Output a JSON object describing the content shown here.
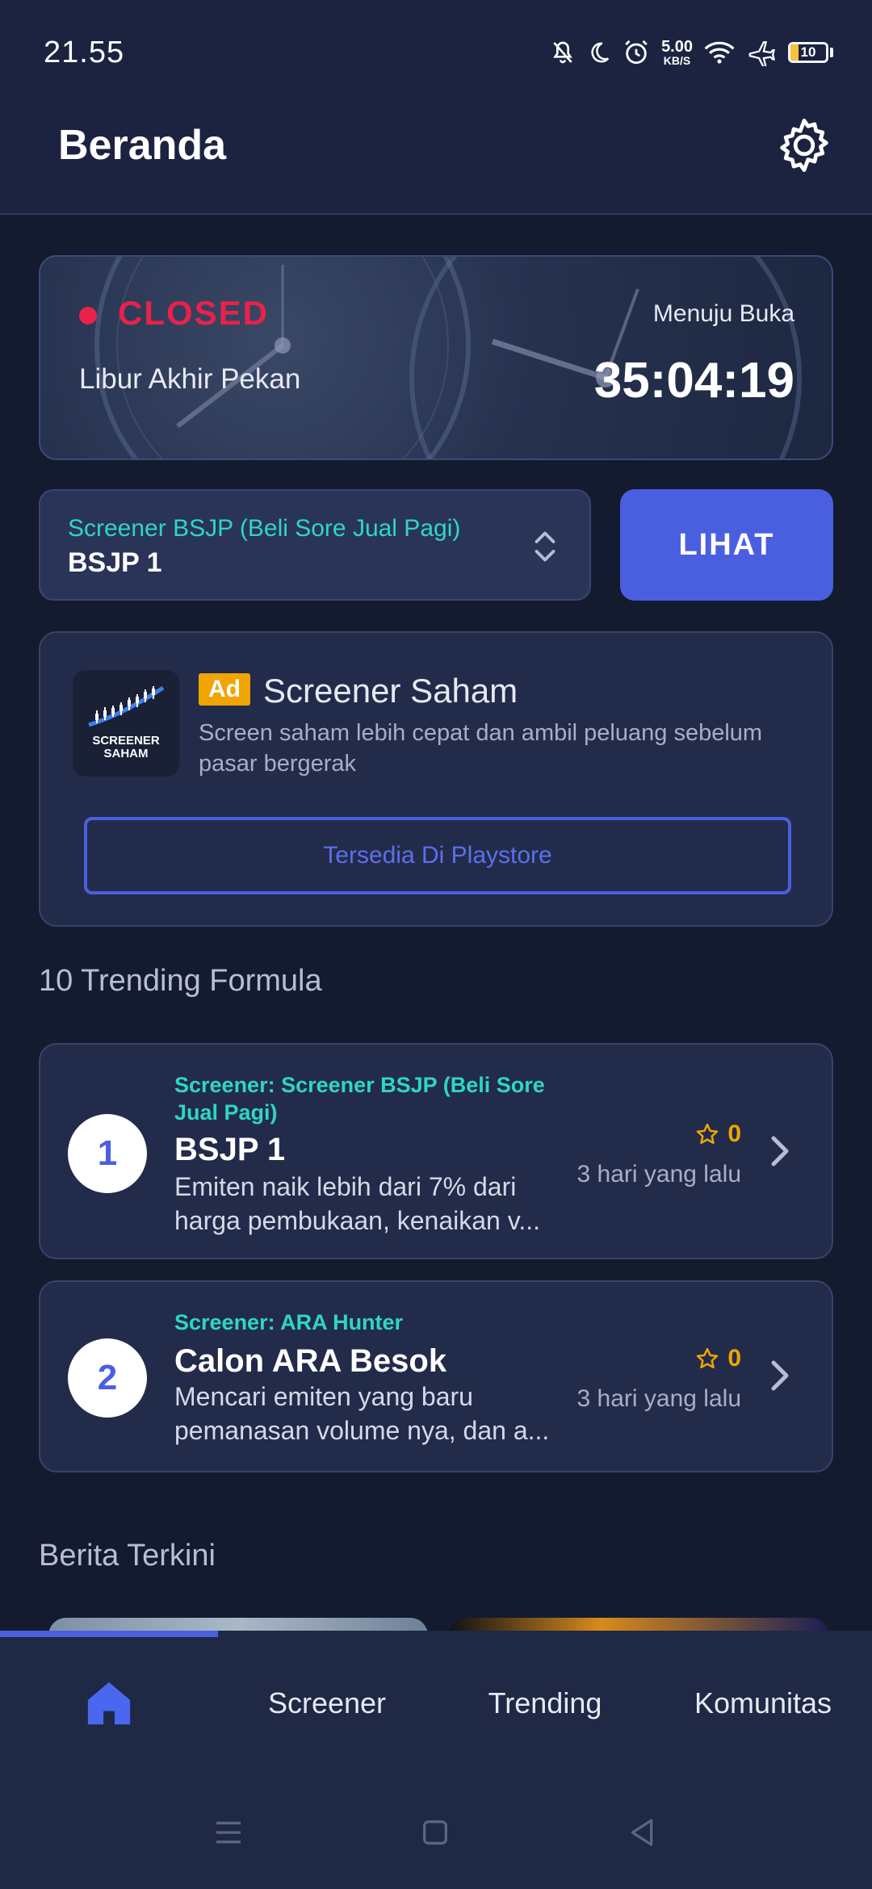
{
  "status_bar": {
    "time": "21.55",
    "speed_value": "5.00",
    "speed_unit": "KB/S",
    "battery": "10",
    "icons": [
      "bell-off-icon",
      "moon-icon",
      "alarm-icon",
      "wifi-icon",
      "airplane-icon",
      "battery-icon"
    ]
  },
  "app_bar": {
    "title": "Beranda",
    "settings_icon": "gear-icon"
  },
  "market": {
    "status": "CLOSED",
    "status_color": "#e8224a",
    "reason": "Libur Akhir Pekan",
    "countdown_caption": "Menuju Buka",
    "countdown": "35:04:19"
  },
  "screener_select": {
    "caption": "Screener BSJP (Beli Sore Jual Pagi)",
    "value": "BSJP 1",
    "button_label": "LIHAT"
  },
  "ad": {
    "badge": "Ad",
    "title": "Screener Saham",
    "description": "Screen saham lebih cepat dan ambil peluang sebelum pasar bergerak",
    "logo_text_1": "SCREENER",
    "logo_text_2": "SAHAM",
    "cta": "Tersedia Di Playstore"
  },
  "trending": {
    "heading": "10 Trending Formula",
    "items": [
      {
        "rank": "1",
        "screener": "Screener: Screener BSJP (Beli Sore Jual Pagi)",
        "name": "BSJP 1",
        "description": "Emiten naik lebih dari 7% dari harga pembukaan, kenaikan v...",
        "stars": "0",
        "time": "3 hari yang lalu"
      },
      {
        "rank": "2",
        "screener": "Screener: ARA Hunter",
        "name": "Calon ARA Besok",
        "description": "Mencari emiten yang baru pemanasan volume nya, dan a...",
        "stars": "0",
        "time": "3 hari yang lalu"
      }
    ]
  },
  "news": {
    "heading": "Berita Terkini"
  },
  "bottom_nav": {
    "items": [
      {
        "label": "",
        "icon": "home-icon",
        "active": true
      },
      {
        "label": "Screener"
      },
      {
        "label": "Trending"
      },
      {
        "label": "Komunitas"
      }
    ],
    "accent": "#4a5fe0"
  },
  "system_nav": {
    "icons": [
      "menu-icon",
      "square-icon",
      "back-icon"
    ]
  }
}
